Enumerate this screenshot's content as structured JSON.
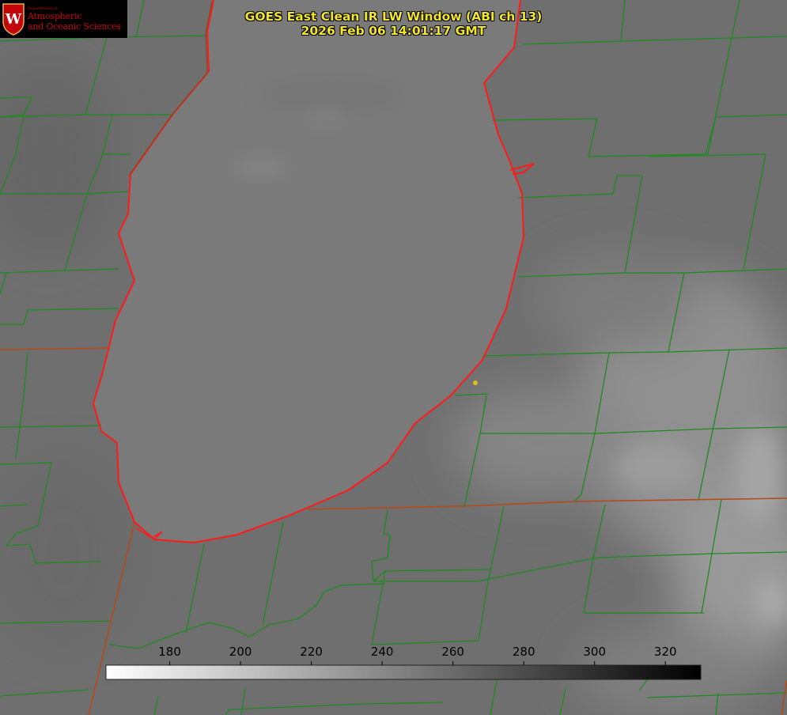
{
  "header": {
    "title_line1": "GOES East Clean IR LW Window (ABI ch 13)",
    "title_line2": "2026 Feb 06 14:01:17 GMT"
  },
  "logo": {
    "dept": "Department of",
    "line1": "Atmospheric",
    "line2": "and Oceanic Sciences",
    "seal_letter": "W"
  },
  "colorbar": {
    "ticks": [
      "180",
      "200",
      "220",
      "240",
      "260",
      "280",
      "300",
      "320"
    ],
    "range": [
      162,
      330
    ],
    "gradient": "white-to-black"
  },
  "colors": {
    "title": "#f2e52b",
    "county_lines": "#1f8a1f",
    "coastline": "#ff1a1a",
    "state_line": "#b34a1a",
    "marker": "#d6c21a",
    "logo_red": "#c5050c"
  }
}
